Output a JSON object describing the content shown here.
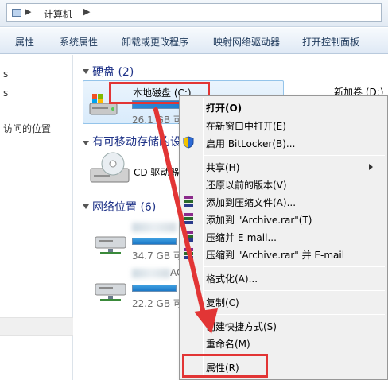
{
  "address": {
    "crumb": "计算机",
    "sep_glyph": "▶"
  },
  "commands": [
    {
      "label": "属性"
    },
    {
      "label": "系统属性"
    },
    {
      "label": "卸载或更改程序"
    },
    {
      "label": "映射网络驱动器"
    },
    {
      "label": "打开控制面板"
    }
  ],
  "nav": {
    "fragments": [
      "s",
      "s",
      "访问的位置"
    ]
  },
  "groups": {
    "hdd": {
      "header": "硬盘 (2)"
    },
    "removable": {
      "header": "有可移动存储的设"
    },
    "network": {
      "header": "网络位置 (6)"
    }
  },
  "drives": {
    "c_label": "本地磁盘 (C:)",
    "c_size": "26.1 GB 可",
    "c_used_fraction": 0.85,
    "d_label": "新加卷 (D:)",
    "cd_label": "CD 驱动器",
    "net1_size": "34.7 GB 可",
    "net2_size": "22.2 GB 可",
    "net2_suffix": "AC"
  },
  "context_menu": {
    "open": "打开(O)",
    "open_new_window": "在新窗口中打开(E)",
    "bitlocker": "启用 BitLocker(B)...",
    "share": "共享(H)",
    "restore": "还原以前的版本(V)",
    "add_archive": "添加到压缩文件(A)...",
    "add_rar": "添加到 \"Archive.rar\"(T)",
    "compress_email": "压缩并 E-mail...",
    "compress_rar_email": "压缩到 \"Archive.rar\" 并 E-mail",
    "format": "格式化(A)...",
    "copy": "复制(C)",
    "create_shortcut": "创建快捷方式(S)",
    "rename": "重命名(M)",
    "properties": "属性(R)"
  },
  "colors": {
    "highlight": "#e23535",
    "group_header": "#1e3287",
    "command_text": "#1e395b"
  }
}
